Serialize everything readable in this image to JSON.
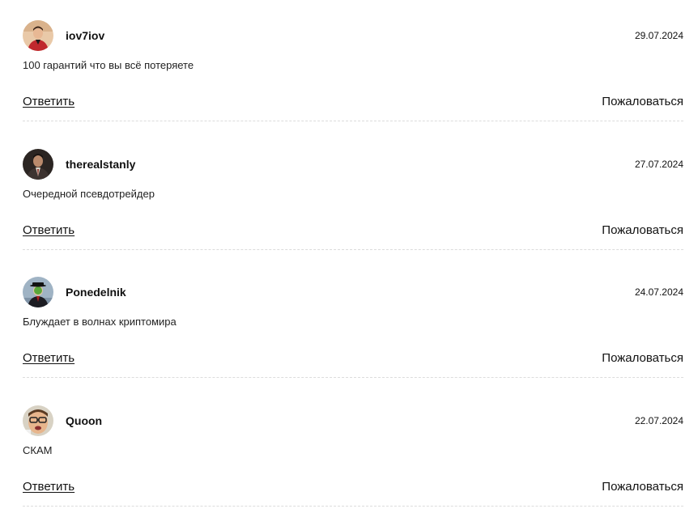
{
  "comments": [
    {
      "username": "iov7iov",
      "date": "29.07.2024",
      "text": "100 гарантий что вы всё потеряете",
      "reply_label": "Ответить",
      "report_label": "Пожаловаться",
      "avatar": "user-avatar-red-shirt"
    },
    {
      "username": "therealstanly",
      "date": "27.07.2024",
      "text": "Очередной псевдотрейдер",
      "reply_label": "Ответить",
      "report_label": "Пожаловаться",
      "avatar": "user-avatar-suit"
    },
    {
      "username": "Ponedelnik",
      "date": "24.07.2024",
      "text": "Блуждает в волнах криптомира",
      "reply_label": "Ответить",
      "report_label": "Пожаловаться",
      "avatar": "user-avatar-bowler-hat-apple"
    },
    {
      "username": "Quoon",
      "date": "22.07.2024",
      "text": "СКАМ",
      "reply_label": "Ответить",
      "report_label": "Пожаловаться",
      "avatar": "user-avatar-glasses-face"
    }
  ],
  "colors": {
    "text": "#111111",
    "divider": "#dcdcdc",
    "background": "#ffffff"
  }
}
